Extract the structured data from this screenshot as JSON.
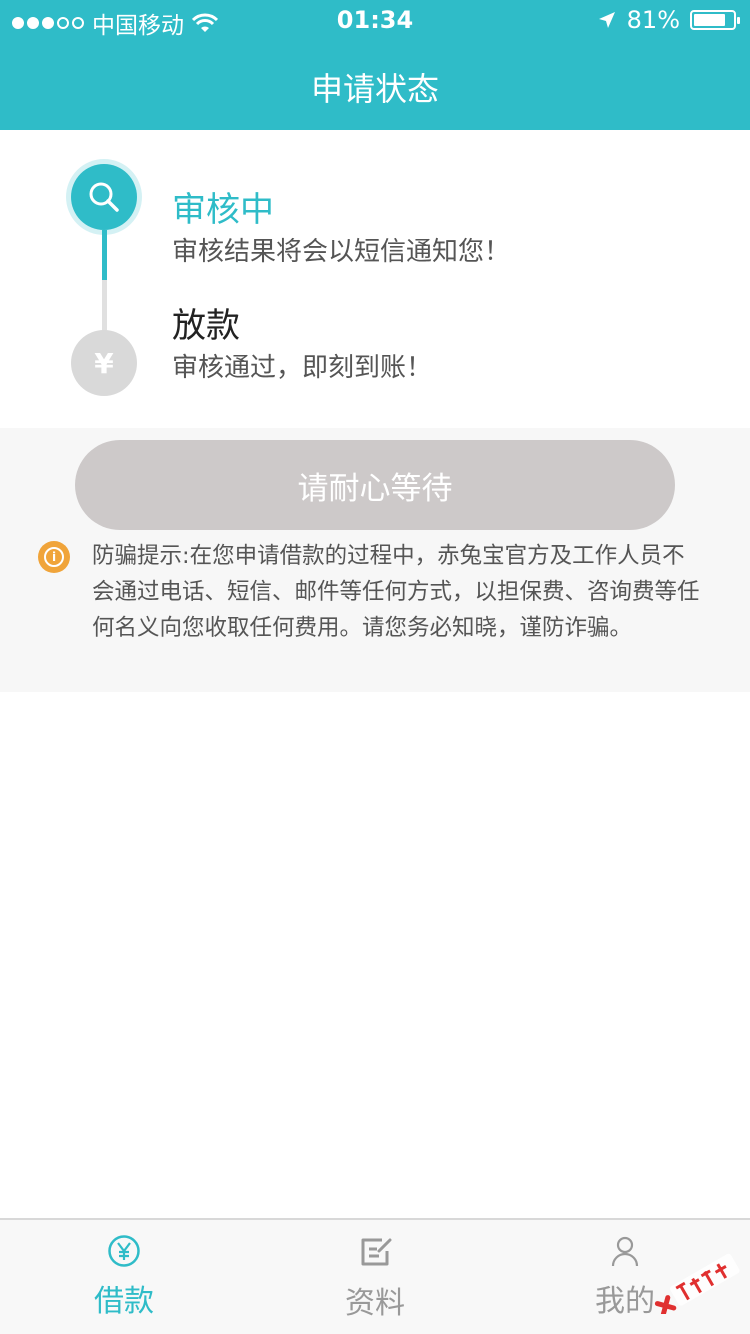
{
  "status_bar": {
    "carrier": "中国移动",
    "time": "01:34",
    "battery": "81%",
    "battery_level": 0.81
  },
  "nav": {
    "title": "申请状态"
  },
  "steps": [
    {
      "title": "审核中",
      "desc": "审核结果将会以短信通知您！",
      "active": true,
      "icon": "search-icon"
    },
    {
      "title": "放款",
      "desc": "审核通过，即刻到账！",
      "active": false,
      "icon": "yen-icon",
      "glyph": "¥"
    }
  ],
  "wait_button": {
    "label": "请耐心等待"
  },
  "warning": {
    "icon": "info-icon",
    "text": "防骗提示:在您申请借款的过程中，赤兔宝官方及工作人员不会通过电话、短信、邮件等任何方式，以担保费、咨询费等任何名义向您收取任何费用。请您务必知晓，谨防诈骗。"
  },
  "tabs": [
    {
      "label": "借款",
      "icon": "yen-circle-icon",
      "active": true
    },
    {
      "label": "资料",
      "icon": "edit-icon",
      "active": false
    },
    {
      "label": "我的",
      "icon": "user-icon",
      "active": false
    }
  ],
  "colors": {
    "accent": "#2fbcc8",
    "warning": "#f0a43a",
    "button_disabled": "#cdc9c9"
  }
}
